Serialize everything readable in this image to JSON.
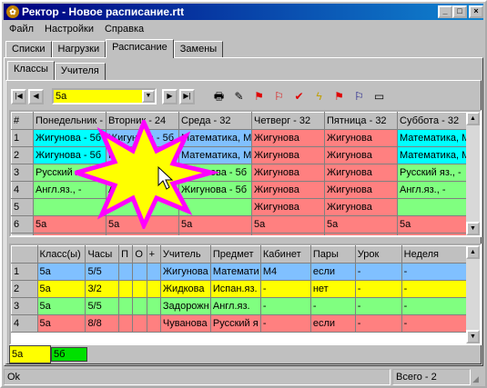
{
  "window": {
    "title": "Ректор - Новое расписание.rtt",
    "icon": "app-icon"
  },
  "menu": [
    "Файл",
    "Настройки",
    "Справка"
  ],
  "tabs_top": [
    "Списки",
    "Нагрузки",
    "Расписание",
    "Замены"
  ],
  "tabs_sub": [
    "Классы",
    "Учителя"
  ],
  "toolbar": {
    "class_value": "5а"
  },
  "schedule": {
    "columns": [
      "#",
      "Понедельник -",
      "Вторник - 24",
      "Среда - 32",
      "Четверг - 32",
      "Пятница - 32",
      "Суббота - 32"
    ],
    "rows": [
      {
        "n": "1",
        "cells": [
          "Жигунова - 5б",
          "Жигунова - 5б",
          "Математика, М",
          "Жигунова",
          "Жигунова",
          "Математика, М"
        ]
      },
      {
        "n": "2",
        "cells": [
          "Жигунова - 5б",
          "Математика, М",
          "Математика, М",
          "Жигунова",
          "Жигунова",
          "Математика, М"
        ]
      },
      {
        "n": "3",
        "cells": [
          "Русский яз., -",
          "",
          "Жигунова - 5б",
          "Жигунова",
          "Жигунова",
          "Русский яз., -"
        ]
      },
      {
        "n": "4",
        "cells": [
          "Англ.яз., -",
          "Англ.яз., -",
          "Жигунова - 5б",
          "Жигунова",
          "Жигунова",
          "Англ.яз., -"
        ]
      },
      {
        "n": "5",
        "cells": [
          "",
          "",
          "",
          "Жигунова",
          "Жигунова",
          ""
        ]
      },
      {
        "n": "6",
        "cells": [
          "5а",
          "5а",
          "5а",
          "5а",
          "5а",
          "5а"
        ]
      },
      {
        "n": "7",
        "cells": [
          "5а",
          "5а",
          "5а",
          "5а",
          "5а",
          "5а"
        ]
      }
    ]
  },
  "lessons": {
    "columns": [
      "",
      "Класс(ы)",
      "Часы",
      "П",
      "О",
      "+",
      "Учитель",
      "Предмет",
      "Кабинет",
      "Пары",
      "Урок",
      "Неделя"
    ],
    "rows": [
      {
        "n": "1",
        "cells": [
          "5а",
          "5/5",
          "",
          "",
          "",
          "Жигунова",
          "Математи",
          "М4",
          "если",
          "-",
          "-"
        ]
      },
      {
        "n": "2",
        "cells": [
          "5а",
          "3/2",
          "",
          "",
          "",
          "Жидкова",
          "Испан.яз.",
          "-",
          "нет",
          "-",
          "-"
        ]
      },
      {
        "n": "3",
        "cells": [
          "5а",
          "5/5",
          "",
          "",
          "",
          "Задорожн",
          "Англ.яз.",
          "-",
          "-",
          "-",
          "-"
        ]
      },
      {
        "n": "4",
        "cells": [
          "5а",
          "8/8",
          "",
          "",
          "",
          "Чуванова",
          "Русский я",
          "-",
          "если",
          "-",
          "-"
        ]
      }
    ]
  },
  "bottom_tabs": [
    "5а",
    "5б"
  ],
  "status": {
    "left": "Ok",
    "right": "Всего - 2"
  },
  "colors": {
    "cyan": "#00ffff",
    "blue": "#80c0ff",
    "green": "#80ff80",
    "red": "#ff8080",
    "yellow": "#ffff00",
    "title": "#000080",
    "star": "#ff00ff"
  }
}
